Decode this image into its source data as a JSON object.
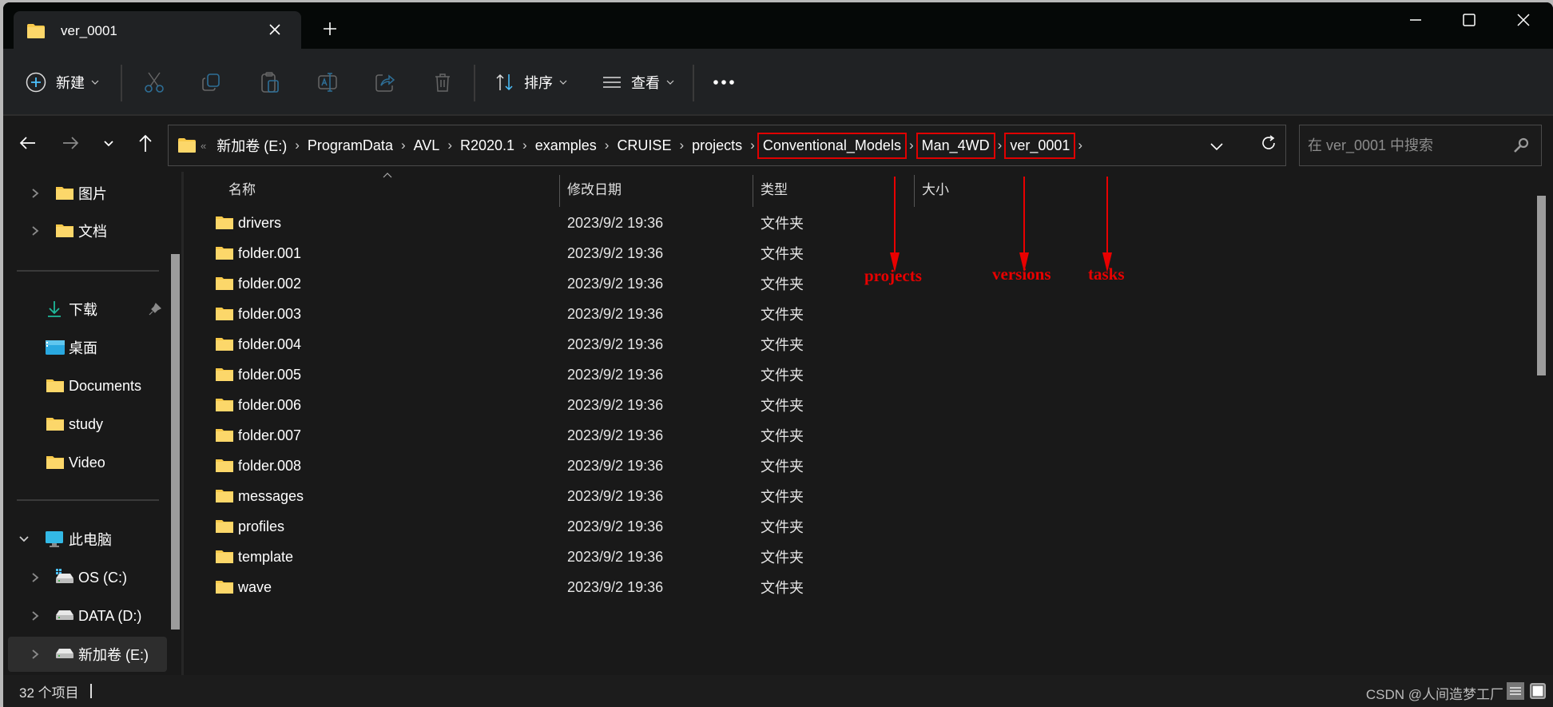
{
  "tab": {
    "title": "ver_0001",
    "close": "close-tab",
    "new": "new-tab"
  },
  "window_controls": [
    "minimize",
    "maximize",
    "close"
  ],
  "toolbar": {
    "new_label": "新建",
    "sort_label": "排序",
    "view_label": "查看",
    "icons": [
      "cut",
      "copy",
      "paste",
      "rename",
      "share",
      "delete"
    ]
  },
  "nav": {
    "breadcrumb_overflow": "«",
    "breadcrumbs": [
      "新加卷 (E:)",
      "ProgramData",
      "AVL",
      "R2020.1",
      "examples",
      "CRUISE",
      "projects",
      "Conventional_Models",
      "Man_4WD",
      "ver_0001"
    ],
    "highlighted": [
      "Conventional_Models",
      "Man_4WD",
      "ver_0001"
    ],
    "search_placeholder": "在 ver_0001 中搜索",
    "search_value": ""
  },
  "sidebar": {
    "quick_items": [
      {
        "label": "图片",
        "icon": "folder-icon",
        "expandable": true
      },
      {
        "label": "文档",
        "icon": "folder-icon",
        "expandable": true
      }
    ],
    "pinned_items": [
      {
        "label": "下载",
        "icon": "download-icon",
        "pinned": true
      },
      {
        "label": "桌面",
        "icon": "desktop-icon"
      },
      {
        "label": "Documents",
        "icon": "folder-icon"
      },
      {
        "label": "study",
        "icon": "folder-icon"
      },
      {
        "label": "Video",
        "icon": "folder-icon"
      }
    ],
    "this_pc": {
      "label": "此电脑",
      "icon": "computer-icon",
      "expanded": true
    },
    "drives": [
      {
        "label": "OS (C:)",
        "icon": "system-drive-icon"
      },
      {
        "label": "DATA (D:)",
        "icon": "drive-icon"
      },
      {
        "label": "新加卷 (E:)",
        "icon": "drive-icon",
        "selected": true
      }
    ]
  },
  "columns": {
    "name": "名称",
    "date": "修改日期",
    "type": "类型",
    "size": "大小"
  },
  "files": [
    {
      "name": "drivers",
      "date": "2023/9/2 19:36",
      "type": "文件夹"
    },
    {
      "name": "folder.001",
      "date": "2023/9/2 19:36",
      "type": "文件夹"
    },
    {
      "name": "folder.002",
      "date": "2023/9/2 19:36",
      "type": "文件夹"
    },
    {
      "name": "folder.003",
      "date": "2023/9/2 19:36",
      "type": "文件夹"
    },
    {
      "name": "folder.004",
      "date": "2023/9/2 19:36",
      "type": "文件夹"
    },
    {
      "name": "folder.005",
      "date": "2023/9/2 19:36",
      "type": "文件夹"
    },
    {
      "name": "folder.006",
      "date": "2023/9/2 19:36",
      "type": "文件夹"
    },
    {
      "name": "folder.007",
      "date": "2023/9/2 19:36",
      "type": "文件夹"
    },
    {
      "name": "folder.008",
      "date": "2023/9/2 19:36",
      "type": "文件夹"
    },
    {
      "name": "messages",
      "date": "2023/9/2 19:36",
      "type": "文件夹"
    },
    {
      "name": "profiles",
      "date": "2023/9/2 19:36",
      "type": "文件夹"
    },
    {
      "name": "template",
      "date": "2023/9/2 19:36",
      "type": "文件夹"
    },
    {
      "name": "wave",
      "date": "2023/9/2 19:36",
      "type": "文件夹"
    }
  ],
  "annotations": [
    {
      "label": "projects",
      "points_to": "Conventional_Models",
      "color": "#e80000"
    },
    {
      "label": "versions",
      "points_to": "Man_4WD",
      "color": "#e80000"
    },
    {
      "label": "tasks",
      "points_to": "ver_0001",
      "color": "#e80000"
    }
  ],
  "status": {
    "item_count": "32 个项目",
    "watermark": "CSDN @人间造梦工厂"
  },
  "colors": {
    "accent": "#4cc2ff",
    "folder": "#f8c94a",
    "annotation": "#e80000",
    "download": "#1fb89a"
  }
}
